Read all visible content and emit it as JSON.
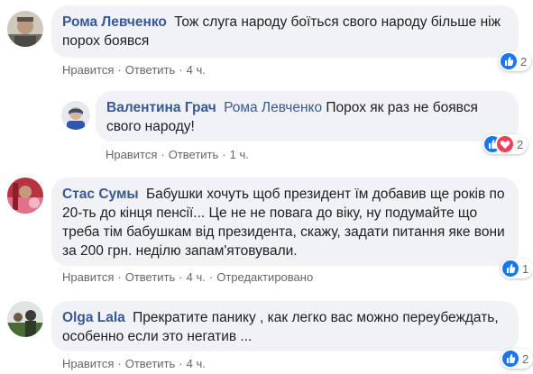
{
  "colors": {
    "author": "#385898",
    "meta": "#65676b",
    "bubble": "#f0f2f5",
    "like": "#1877f2",
    "love": "#f33e58"
  },
  "comments": [
    {
      "author": "Рома Левченко",
      "text": "Тож слуга народу боїться свого народу більше ніж порох боявся",
      "actions": {
        "like": "Нравится",
        "reply": "Ответить",
        "time": "4 ч."
      },
      "reactions": {
        "icons": [
          "like-icon"
        ],
        "count": "2"
      }
    },
    {
      "author": "Валентина Грач",
      "mention": "Рома Левченко",
      "text": "Порох як раз не боявся свого народу!",
      "actions": {
        "like": "Нравится",
        "reply": "Ответить",
        "time": "1 ч."
      },
      "reactions": {
        "icons": [
          "like-icon",
          "love-icon"
        ],
        "count": "2"
      }
    },
    {
      "author": "Стас Сумы",
      "text": "Бабушки хочуть щоб президент їм добавив ще років по 20-ть до кінця пенсії... Це не не повага до віку, ну подумайте що треба тім бабушкам від президента, скажу, задати питання яке вони за 200 грн. неділю запам'ятовували.",
      "actions": {
        "like": "Нравится",
        "reply": "Ответить",
        "time": "4 ч.",
        "edited": "Отредактировано"
      },
      "reactions": {
        "icons": [
          "like-icon"
        ],
        "count": "1"
      }
    },
    {
      "author": "Olga Lala",
      "text": "Прекратите панику , как легко вас можно переубеждать, особенно если это негатив ...",
      "actions": {
        "like": "Нравится",
        "reply": "Ответить",
        "time": "4 ч."
      },
      "reactions": {
        "icons": [
          "like-icon"
        ],
        "count": "2"
      }
    }
  ]
}
